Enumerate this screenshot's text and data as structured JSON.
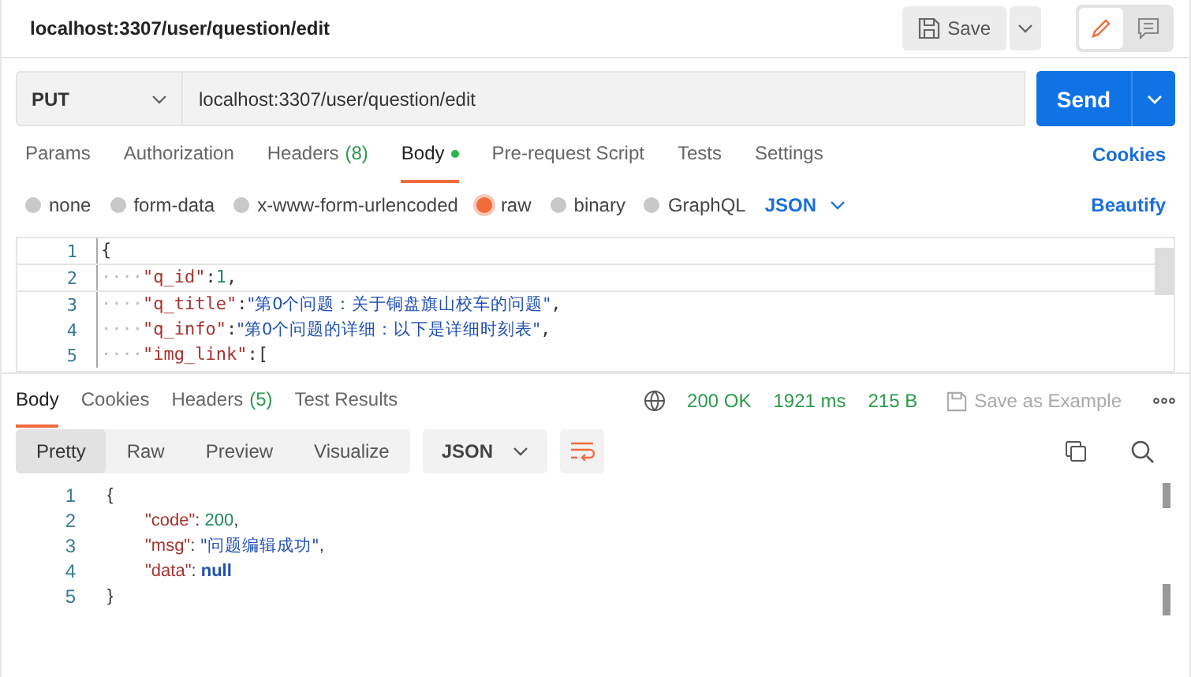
{
  "header": {
    "title": "localhost:3307/user/question/edit",
    "save": "Save"
  },
  "request": {
    "method": "PUT",
    "url": "localhost:3307/user/question/edit",
    "send": "Send"
  },
  "tabs": [
    {
      "label": "Params",
      "dot": false,
      "selected": false
    },
    {
      "label": "Authorization",
      "dot": false,
      "selected": false
    },
    {
      "label": "Headers",
      "count": "(8)",
      "dot": false,
      "selected": false
    },
    {
      "label": "Body",
      "dot": true,
      "selected": true
    },
    {
      "label": "Pre-request Script",
      "dot": false,
      "selected": false
    },
    {
      "label": "Tests",
      "dot": false,
      "selected": false
    },
    {
      "label": "Settings",
      "dot": false,
      "selected": false
    }
  ],
  "cookies": "Cookies",
  "body_types": [
    {
      "label": "none",
      "selected": false
    },
    {
      "label": "form-data",
      "selected": false
    },
    {
      "label": "x-www-form-urlencoded",
      "selected": false
    },
    {
      "label": "raw",
      "selected": true
    },
    {
      "label": "binary",
      "selected": false
    },
    {
      "label": "GraphQL",
      "selected": false
    }
  ],
  "body_format": "JSON",
  "beautify": "Beautify",
  "request_code": [
    {
      "number": "1",
      "tokens": [
        {
          "kind": "punct",
          "text": "{"
        }
      ]
    },
    {
      "number": "2",
      "tokens": [
        {
          "kind": "indent",
          "text": "····"
        },
        {
          "kind": "key",
          "text": "\"q_id\""
        },
        {
          "kind": "punct",
          "text": ":"
        },
        {
          "kind": "number",
          "text": "1"
        },
        {
          "kind": "punct",
          "text": ","
        }
      ]
    },
    {
      "number": "3",
      "tokens": [
        {
          "kind": "indent",
          "text": "····"
        },
        {
          "kind": "key",
          "text": "\"q_title\""
        },
        {
          "kind": "punct",
          "text": ":"
        },
        {
          "kind": "string",
          "text": "\"第0个问题：关于铜盘旗山校车的问题\""
        },
        {
          "kind": "punct",
          "text": ","
        }
      ]
    },
    {
      "number": "4",
      "tokens": [
        {
          "kind": "indent",
          "text": "····"
        },
        {
          "kind": "key",
          "text": "\"q_info\""
        },
        {
          "kind": "punct",
          "text": ":"
        },
        {
          "kind": "string",
          "text": "\"第0个问题的详细：以下是详细时刻表\""
        },
        {
          "kind": "punct",
          "text": ","
        }
      ]
    },
    {
      "number": "5",
      "tokens": [
        {
          "kind": "indent",
          "text": "····"
        },
        {
          "kind": "key",
          "text": "\"img_link\""
        },
        {
          "kind": "punct",
          "text": ":["
        }
      ]
    }
  ],
  "response_tabs": [
    {
      "label": "Body",
      "selected": true
    },
    {
      "label": "Cookies",
      "selected": false
    },
    {
      "label": "Headers",
      "count": "(5)",
      "selected": false
    },
    {
      "label": "Test Results",
      "selected": false
    }
  ],
  "status": {
    "code": "200 OK",
    "time": "1921 ms",
    "size": "215 B",
    "save_example": "Save as Example"
  },
  "views": [
    {
      "label": "Pretty",
      "selected": true
    },
    {
      "label": "Raw",
      "selected": false
    },
    {
      "label": "Preview",
      "selected": false
    },
    {
      "label": "Visualize",
      "selected": false
    }
  ],
  "response_format": "JSON",
  "response_code": [
    {
      "number": "1",
      "kind": "brace",
      "tokens": [
        {
          "kind": "punct",
          "text": "{"
        }
      ]
    },
    {
      "number": "2",
      "kind": "member",
      "tokens": [
        {
          "kind": "key",
          "text": "\"code\""
        },
        {
          "kind": "punct",
          "text": ": "
        },
        {
          "kind": "number",
          "text": "200"
        },
        {
          "kind": "punct",
          "text": ","
        }
      ]
    },
    {
      "number": "3",
      "kind": "member",
      "tokens": [
        {
          "kind": "key",
          "text": "\"msg\""
        },
        {
          "kind": "punct",
          "text": ": "
        },
        {
          "kind": "string",
          "text": "\"问题编辑成功\""
        },
        {
          "kind": "punct",
          "text": ","
        }
      ]
    },
    {
      "number": "4",
      "kind": "member",
      "tokens": [
        {
          "kind": "key",
          "text": "\"data\""
        },
        {
          "kind": "punct",
          "text": ": "
        },
        {
          "kind": "keyword",
          "text": "null"
        }
      ]
    },
    {
      "number": "5",
      "kind": "brace",
      "tokens": [
        {
          "kind": "punct",
          "text": "}"
        }
      ]
    }
  ]
}
